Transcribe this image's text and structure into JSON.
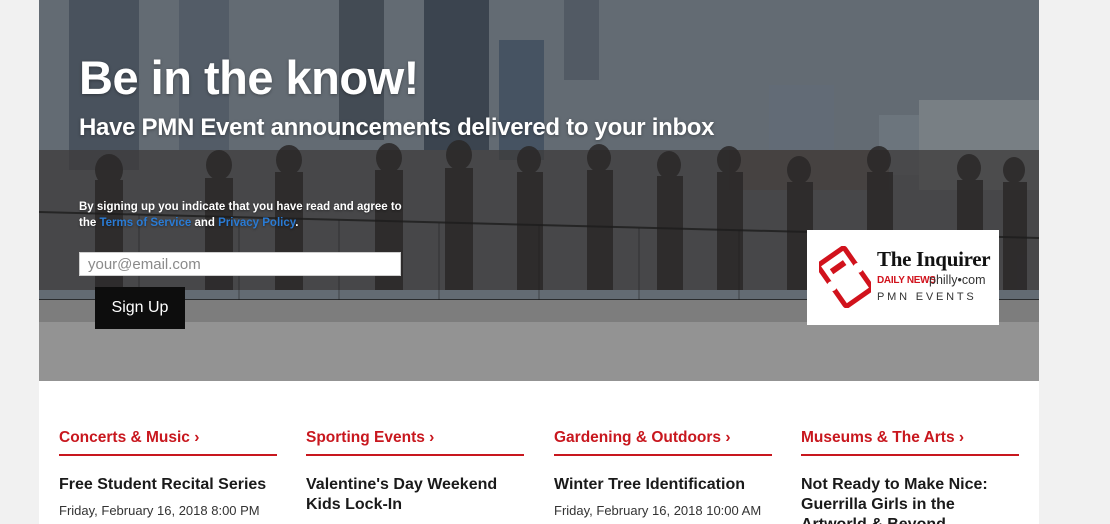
{
  "hero": {
    "title": "Be in the know!",
    "subtitle": "Have PMN Event announcements delivered to your inbox",
    "consent_prefix": "By signing up you indicate that you have read and agree to the ",
    "terms_link": "Terms of Service",
    "consent_and": " and ",
    "privacy_link": "Privacy Policy",
    "consent_suffix": ".",
    "email_placeholder": "your@email.com",
    "signup_label": "Sign Up"
  },
  "logo": {
    "line1": "The Inquirer",
    "line2a": "DAILY NEWS",
    "line2b": "philly•com",
    "line3": "PMN EVENTS"
  },
  "categories": [
    {
      "label": "Concerts & Music ›",
      "event_title": "Free Student Recital Series",
      "event_date": "Friday, February 16, 2018 8:00 PM"
    },
    {
      "label": "Sporting Events ›",
      "event_title": "Valentine's Day Weekend Kids Lock-In",
      "event_date": ""
    },
    {
      "label": "Gardening & Outdoors ›",
      "event_title": "Winter Tree Identification",
      "event_date": "Friday, February 16, 2018 10:00 AM"
    },
    {
      "label": "Museums & The Arts ›",
      "event_title": "Not Ready to Make Nice: Guerrilla Girls in the Artworld & Beyond",
      "event_date": ""
    }
  ],
  "colors": {
    "accent_red": "#c8171e",
    "link_blue": "#2a7bd4"
  }
}
